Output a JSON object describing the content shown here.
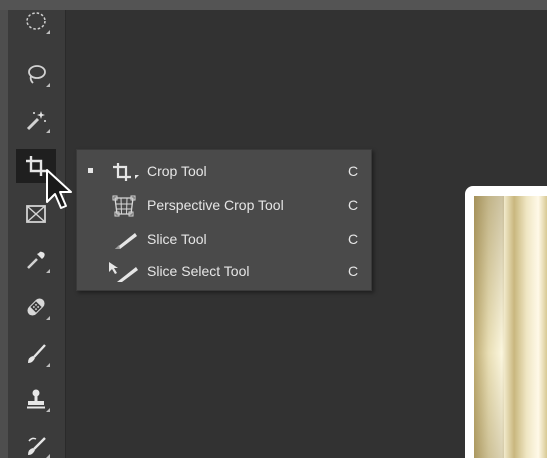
{
  "toolbar": {
    "tools": [
      {
        "name": "elliptical-marquee-tool",
        "icon": "elliptical-marquee-icon"
      },
      {
        "name": "lasso-tool",
        "icon": "lasso-icon"
      },
      {
        "name": "magic-wand-tool",
        "icon": "magic-wand-icon"
      },
      {
        "name": "crop-tool",
        "icon": "crop-icon",
        "active": true
      },
      {
        "name": "frame-tool",
        "icon": "frame-icon"
      },
      {
        "name": "eyedropper-tool",
        "icon": "eyedropper-icon"
      },
      {
        "name": "healing-brush-tool",
        "icon": "bandage-icon"
      },
      {
        "name": "brush-tool",
        "icon": "brush-icon"
      },
      {
        "name": "clone-stamp-tool",
        "icon": "stamp-icon"
      },
      {
        "name": "history-brush-tool",
        "icon": "history-brush-icon"
      }
    ]
  },
  "flyout": {
    "items": [
      {
        "label": "Crop Tool",
        "shortcut": "C",
        "icon": "crop-icon",
        "selected": true
      },
      {
        "label": "Perspective Crop Tool",
        "shortcut": "C",
        "icon": "perspective-crop-icon",
        "selected": false
      },
      {
        "label": "Slice Tool",
        "shortcut": "C",
        "icon": "slice-icon",
        "selected": false
      },
      {
        "label": "Slice Select Tool",
        "shortcut": "C",
        "icon": "slice-select-icon",
        "selected": false
      }
    ]
  },
  "colors": {
    "workspace": "#323232",
    "toolbar": "#3b3b3b",
    "flyout": "#4a4a4a",
    "text": "#e6e6e6"
  }
}
